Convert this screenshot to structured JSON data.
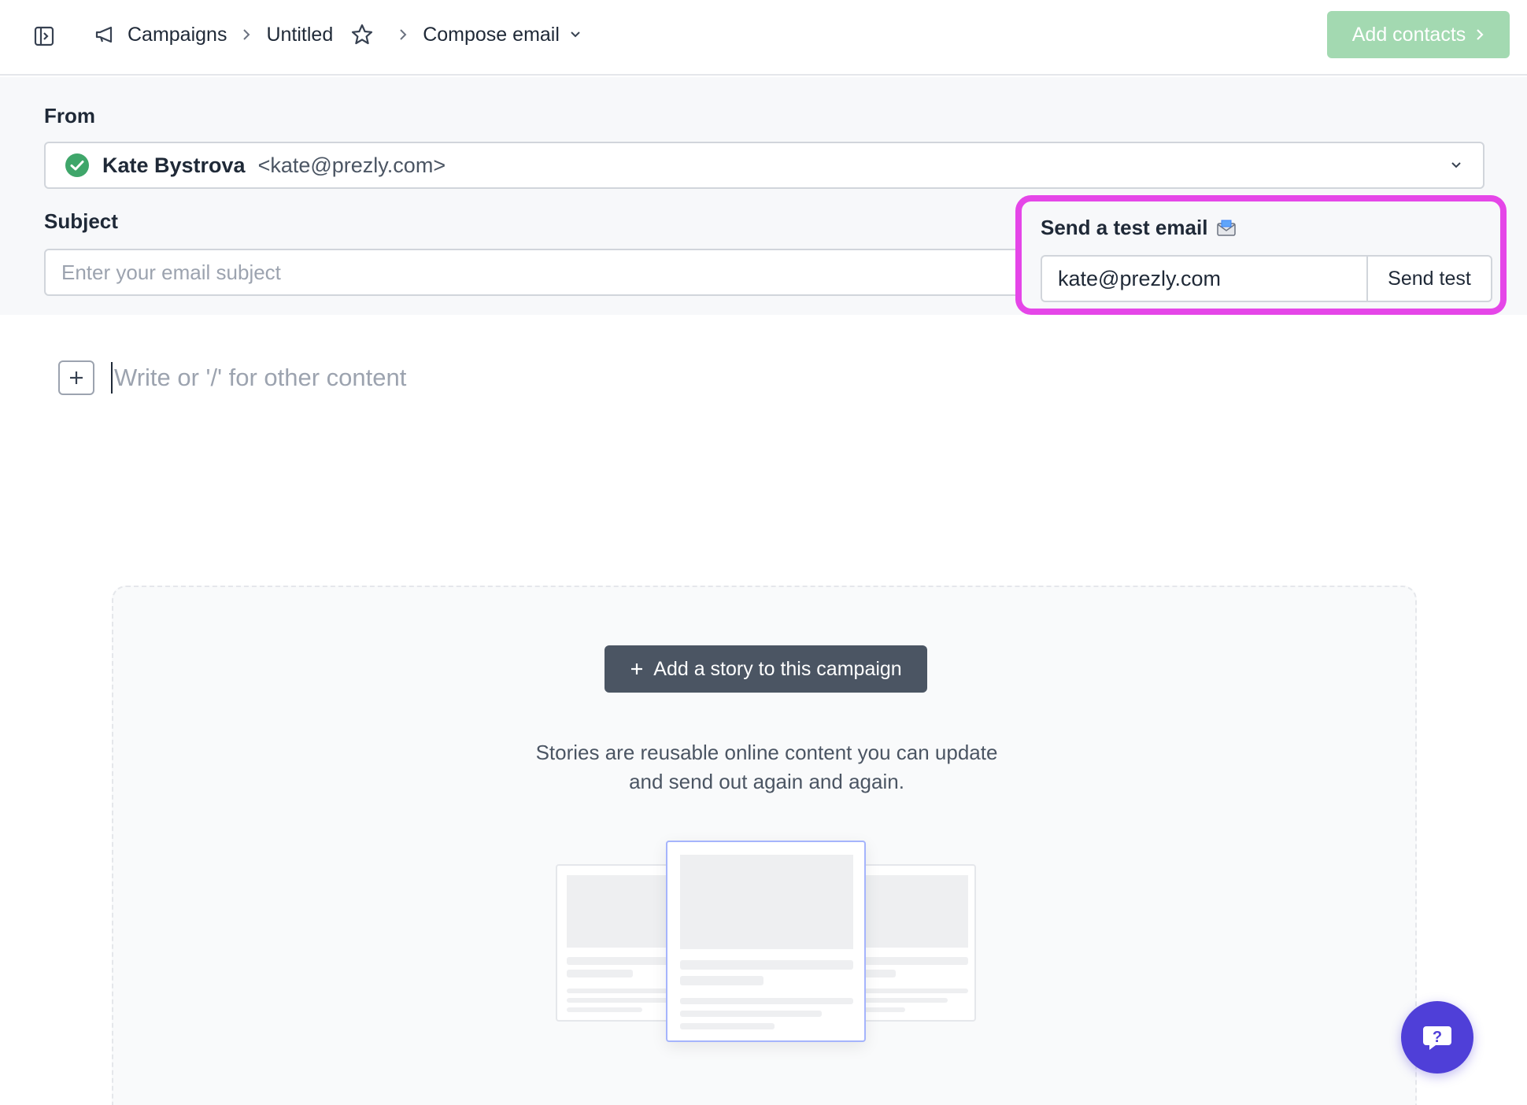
{
  "breadcrumb": {
    "campaigns": "Campaigns",
    "untitled": "Untitled",
    "compose": "Compose email"
  },
  "header": {
    "add_contacts_label": "Add contacts"
  },
  "form": {
    "from_label": "From",
    "sender_name": "Kate Bystrova",
    "sender_email": "<kate@prezly.com>",
    "subject_label": "Subject",
    "subject_placeholder": "Enter your email subject",
    "subject_value": ""
  },
  "test_email": {
    "title": "Send a test email",
    "email_value": "kate@prezly.com",
    "send_label": "Send test"
  },
  "editor": {
    "placeholder": "Write or '/' for other content"
  },
  "stories": {
    "add_label": "Add a story to this campaign",
    "description_line1": "Stories are reusable online content you can update",
    "description_line2": "and send out again and again."
  },
  "colors": {
    "accent_green": "#a3d9b1",
    "highlight_magenta": "#e546e8",
    "help_purple": "#4f3fd8",
    "dark_button": "#4b5563"
  }
}
